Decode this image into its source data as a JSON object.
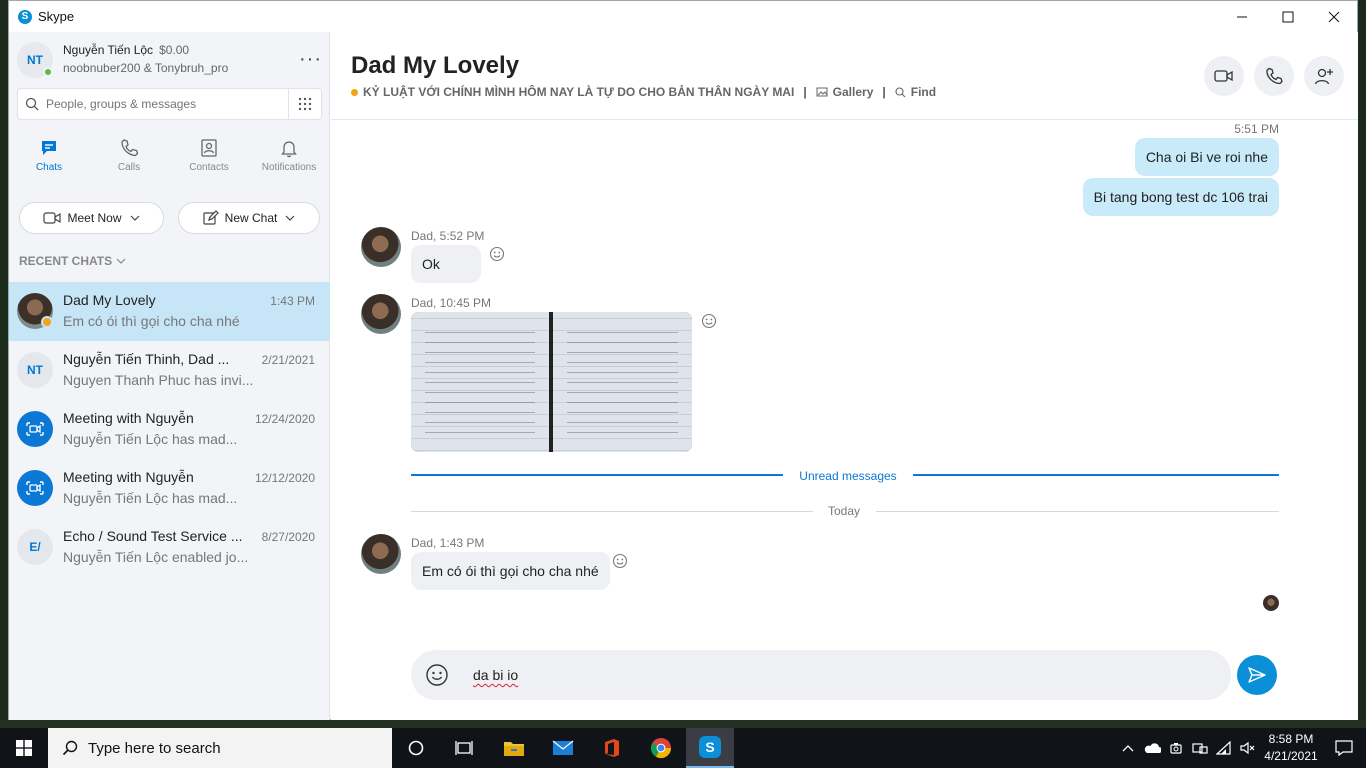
{
  "window": {
    "title": "Skype"
  },
  "profile": {
    "initials": "NT",
    "name": "Nguyễn Tiến Lộc",
    "credit": "$0.00",
    "subtitle": "noobnuber200 & Tonybruh_pro"
  },
  "search": {
    "placeholder": "People, groups & messages"
  },
  "nav": {
    "tabs": [
      {
        "label": "Chats",
        "active": true
      },
      {
        "label": "Calls"
      },
      {
        "label": "Contacts"
      },
      {
        "label": "Notifications"
      }
    ]
  },
  "actions": {
    "meet_now": "Meet Now",
    "new_chat": "New Chat"
  },
  "recent": {
    "label": "RECENT CHATS",
    "items": [
      {
        "name": "Dad My Lovely",
        "date": "1:43 PM",
        "last": "Em có ói thì gọi cho cha nhé"
      },
      {
        "name": "Nguyễn Tiến Thinh, Dad ...",
        "date": "2/21/2021",
        "last": "Nguyen Thanh Phuc has invi...",
        "initials": "NT"
      },
      {
        "name": "Meeting with Nguyễn",
        "date": "12/24/2020",
        "last": "Nguyễn Tiến Lộc has mad..."
      },
      {
        "name": "Meeting with Nguyễn",
        "date": "12/12/2020",
        "last": "Nguyễn Tiến Lộc has mad..."
      },
      {
        "name": "Echo / Sound Test Service ...",
        "date": "8/27/2020",
        "last": "Nguyễn Tiến Lộc enabled jo...",
        "initials": "E/"
      }
    ]
  },
  "conversation": {
    "title": "Dad My Lovely",
    "mood": "KỶ LUẬT VỚI CHÍNH MÌNH HÔM NAY LÀ TỰ DO CHO BẢN THÂN NGÀY MAI",
    "separator": "|",
    "gallery": "Gallery",
    "find": "Find",
    "messages": {
      "out_time": "5:51 PM",
      "out1": "Cha oi Bi ve roi nhe",
      "out2": "Bi tang bong test dc 106 trai",
      "in1_meta": "Dad, 5:52 PM",
      "in1_text": "Ok",
      "in2_meta": "Dad, 10:45 PM",
      "in3_meta": "Dad, 1:43 PM",
      "in3_text": "Em có ói thì gọi cho cha nhé"
    },
    "unread_label": "Unread messages",
    "today_label": "Today",
    "composer_text": "da bi io"
  },
  "taskbar": {
    "search_text": "Type here to search",
    "time": "8:58 PM",
    "date": "4/21/2021"
  },
  "colors": {
    "accent": "#0078d4",
    "outgoing_bubble": "#c9eaf9",
    "active_chat": "#c6e6f7"
  }
}
